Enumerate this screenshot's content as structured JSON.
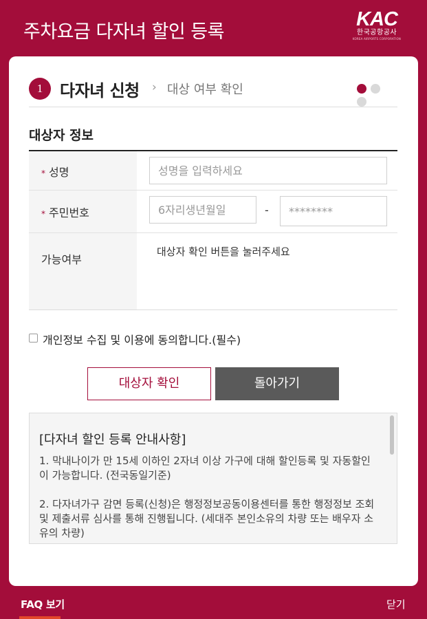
{
  "header": {
    "title": "주차요금 다자녀 할인 등록",
    "logo_mark": "KAC",
    "logo_korean": "한국공항공사",
    "logo_english": "KOREA AIRPORTS CORPORATION"
  },
  "steps": {
    "current_number": "1",
    "current_label": "다자녀 신청",
    "arrow": "›",
    "next_label": "대상 여부 확인",
    "total": 3,
    "active_index": 1
  },
  "form": {
    "section_title": "대상자 정보",
    "required_mark": "*",
    "name_label": "성명",
    "name_placeholder": "성명을 입력하세요",
    "jumin_label": "주민번호",
    "jumin_front_placeholder": "6자리생년월일",
    "jumin_separator": "-",
    "jumin_back_placeholder": "********",
    "availability_label": "가능여부",
    "availability_message": "대상자 확인 버튼을 눌러주세요"
  },
  "agreement": {
    "label": "개인정보 수집 및 이용에 동의합니다.(필수)",
    "checked": false
  },
  "buttons": {
    "check_target": "대상자 확인",
    "go_back": "돌아가기"
  },
  "notice": {
    "title": "[다자녀 할인 등록 안내사항]",
    "paragraph_1": "1. 막내나이가 만 15세 이하인 2자녀 이상 가구에 대해 할인등록 및 자동할인이 가능합니다. (전국동일기준)",
    "paragraph_2": "2. 다자녀가구 감면 등록(신청)은 행정정보공동이용센터를 통한 행정정보 조회 및 제출서류 심사를 통해 진행됩니다. (세대주 본인소유의 차량 또는 배우자 소유의 차량)"
  },
  "footer": {
    "faq_label": "FAQ 보기",
    "close_label": "닫기"
  },
  "colors": {
    "brand": "#a30d3a",
    "button_dark": "#5a5a5a",
    "faq_underline": "#e2472a"
  }
}
